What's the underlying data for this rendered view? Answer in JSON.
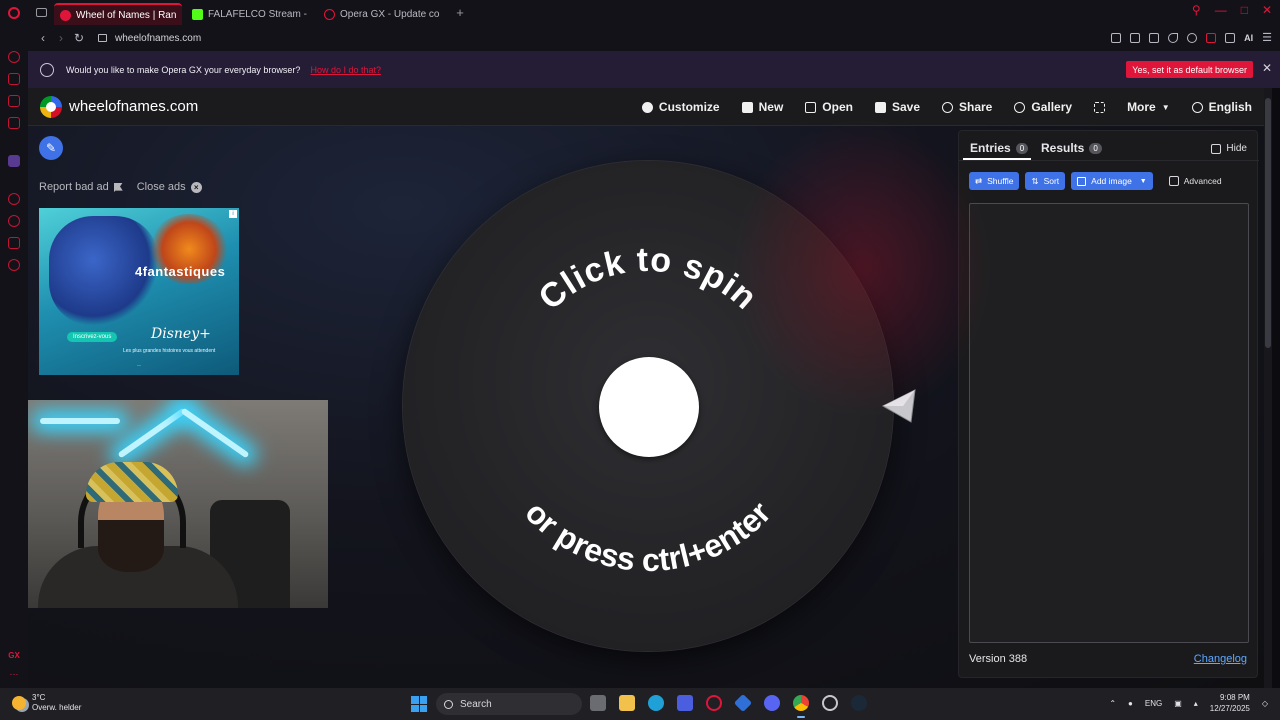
{
  "browser": {
    "tabs": [
      {
        "title": "Wheel of Names | Random",
        "active": true,
        "favicon_color": "#e0153a"
      },
      {
        "title": "FALAFELCO Stream - Wat",
        "active": false,
        "favicon_color": "#53fc18"
      },
      {
        "title": "Opera GX - Update comp",
        "active": false,
        "favicon_color": "#e0153a"
      }
    ],
    "url": "wheelofnames.com",
    "infobar": {
      "message": "Would you like to make Opera GX your everyday browser?",
      "link": "How do I do that?",
      "button": "Yes, set it as default browser"
    },
    "ai_label": "AI",
    "accent_color": "#e0153a"
  },
  "site": {
    "name": "wheelofnames.com",
    "menu": [
      {
        "label": "Customize",
        "icon": "palette-icon"
      },
      {
        "label": "New",
        "icon": "file-icon"
      },
      {
        "label": "Open",
        "icon": "folder-open-icon"
      },
      {
        "label": "Save",
        "icon": "floppy-disk-icon"
      },
      {
        "label": "Share",
        "icon": "share-icon"
      },
      {
        "label": "Gallery",
        "icon": "search-icon"
      },
      {
        "label": "",
        "icon": "fullscreen-icon"
      },
      {
        "label": "More",
        "icon": "caret-down-icon"
      },
      {
        "label": "English",
        "icon": "globe-icon"
      }
    ],
    "ad_links": {
      "report": "Report bad ad",
      "close": "Close ads"
    },
    "ad": {
      "title": "4fantastiques",
      "cta": "Inscrivez-vous",
      "brand": "Disney+",
      "tagline": "Les plus grandes histoires vous attendent"
    },
    "wheel": {
      "top_text": "Click to spin",
      "bottom_text": "or press ctrl+enter"
    },
    "panel": {
      "tabs": [
        {
          "label": "Entries",
          "count": "0",
          "active": true
        },
        {
          "label": "Results",
          "count": "0",
          "active": false
        }
      ],
      "hide_label": "Hide",
      "buttons": [
        "Shuffle",
        "Sort",
        "Add image"
      ],
      "advanced_label": "Advanced",
      "version": "Version 388",
      "changelog": "Changelog"
    },
    "primary_color": "#3f72e6"
  },
  "taskbar": {
    "weather": {
      "temp": "3°C",
      "desc": "Overw. helder"
    },
    "search_placeholder": "Search",
    "lang": "ENG",
    "time": "9:08 PM",
    "date": "12/27/2025"
  }
}
